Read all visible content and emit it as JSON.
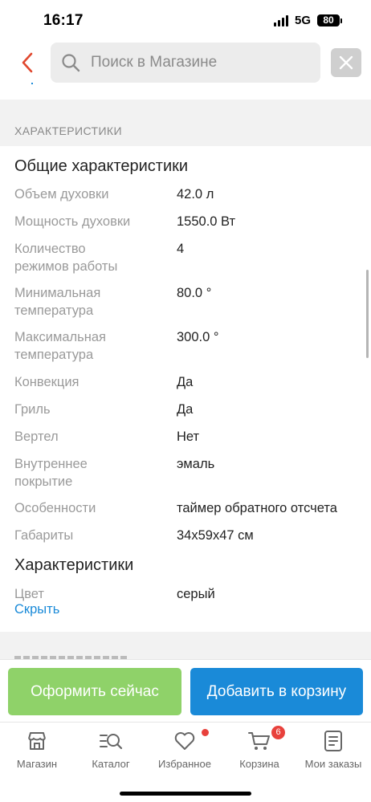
{
  "status_bar": {
    "time": "16:17",
    "network": "5G",
    "battery": "80"
  },
  "search": {
    "placeholder": "Поиск в Магазине"
  },
  "section_header": "ХАРАКТЕРИСТИКИ",
  "groups": [
    {
      "title": "Общие характеристики",
      "specs": [
        {
          "label": "Объем духовки",
          "value": "42.0 л"
        },
        {
          "label": "Мощность духовки",
          "value": "1550.0 Вт"
        },
        {
          "label": "Количество режимов работы",
          "value": "4"
        },
        {
          "label": "Минимальная температура",
          "value": "80.0 °"
        },
        {
          "label": "Максимальная температура",
          "value": "300.0 °"
        },
        {
          "label": "Конвекция",
          "value": "Да"
        },
        {
          "label": "Гриль",
          "value": "Да"
        },
        {
          "label": "Вертел",
          "value": "Нет"
        },
        {
          "label": "Внутреннее покрытие",
          "value": "эмаль"
        },
        {
          "label": "Особенности",
          "value": "таймер обратного отсчета"
        },
        {
          "label": "Габариты",
          "value": "34x59x47 см"
        }
      ]
    },
    {
      "title": "Характеристики",
      "specs": [
        {
          "label": "Цвет",
          "value": "серый"
        }
      ]
    }
  ],
  "hide_link": "Скрыть",
  "actions": {
    "buy_now": "Оформить сейчас",
    "add_to_cart": "Добавить в корзину"
  },
  "tabs": [
    {
      "label": "Магазин",
      "icon": "store-icon"
    },
    {
      "label": "Каталог",
      "icon": "catalog-search-icon"
    },
    {
      "label": "Избранное",
      "icon": "heart-icon"
    },
    {
      "label": "Корзина",
      "icon": "cart-icon",
      "badge": "6"
    },
    {
      "label": "Мои заказы",
      "icon": "orders-icon"
    }
  ],
  "colors": {
    "accent_blue": "#1a8ad8",
    "buy_green": "#8fd269",
    "badge_red": "#e8413c",
    "back_red": "#e0472e"
  }
}
